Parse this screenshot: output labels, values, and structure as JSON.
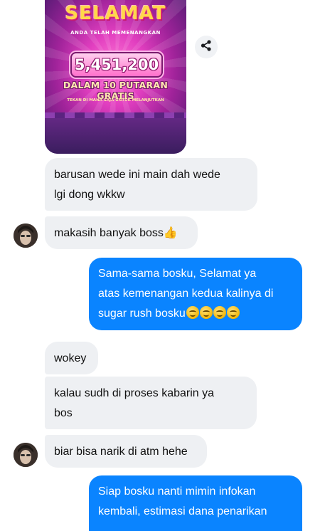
{
  "image": {
    "title": "SELAMAT",
    "caption": "ANDA TELAH MEMENANGKAN",
    "amount": "5,451,200",
    "spins": "DALAM 10 PUTARAN GRATIS",
    "continue": "TEKAN DI MANA SAJA UNTUK MELANJUTKAN"
  },
  "share": {
    "icon": "share-icon"
  },
  "messages": [
    {
      "direction": "in",
      "lines": [
        "barusan wede ini main dah wede",
        "lgi dong wkkw"
      ]
    },
    {
      "direction": "in",
      "lines": [
        "makasih banyak boss"
      ],
      "emoji": "thumbs-up"
    },
    {
      "direction": "out",
      "lines": [
        "Sama-sama bosku, Selamat ya",
        "atas kemenangan kedua kalinya di",
        "sugar rush bosku"
      ],
      "emoji": "smiling-face",
      "emoji_count": 4
    },
    {
      "direction": "in",
      "lines": [
        "wokey"
      ]
    },
    {
      "direction": "in",
      "lines": [
        "kalau sudh di proses kabarin ya",
        "bos"
      ]
    },
    {
      "direction": "in",
      "lines": [
        "biar bisa narik di atm hehe"
      ]
    },
    {
      "direction": "out",
      "lines": [
        "Siap bosku nanti mimin infokan",
        "kembali, estimasi dana penarikan"
      ]
    }
  ],
  "colors": {
    "incoming_bubble": "#eef0f3",
    "outgoing_bubble": "#0a84ff"
  }
}
